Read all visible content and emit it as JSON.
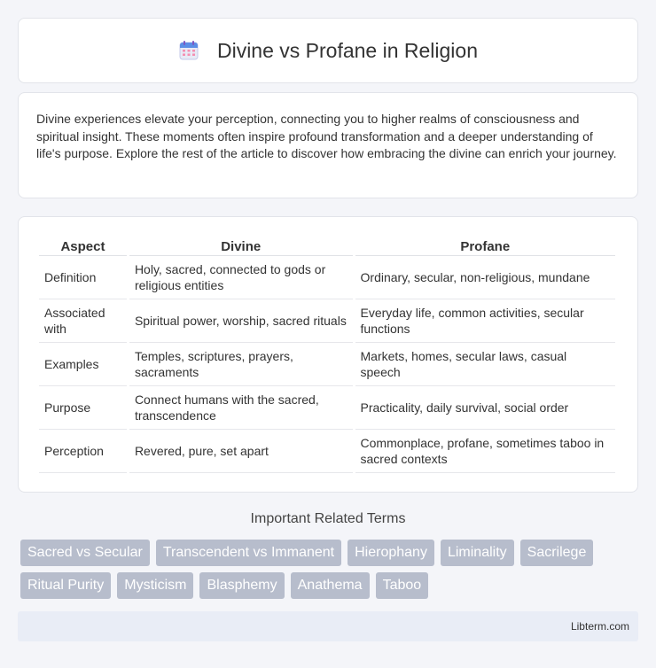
{
  "header": {
    "title": "Divine vs Profane in Religion",
    "icon": "calendar-icon"
  },
  "intro": {
    "text": "Divine experiences elevate your perception, connecting you to higher realms of consciousness and spiritual insight. These moments often inspire profound transformation and a deeper understanding of life's purpose. Explore the rest of the article to discover how embracing the divine can enrich your journey."
  },
  "table": {
    "headers": [
      "Aspect",
      "Divine",
      "Profane"
    ],
    "rows": [
      [
        "Definition",
        "Holy, sacred, connected to gods or religious entities",
        "Ordinary, secular, non-religious, mundane"
      ],
      [
        "Associated with",
        "Spiritual power, worship, sacred rituals",
        "Everyday life, common activities, secular functions"
      ],
      [
        "Examples",
        "Temples, scriptures, prayers, sacraments",
        "Markets, homes, secular laws, casual speech"
      ],
      [
        "Purpose",
        "Connect humans with the sacred, transcendence",
        "Practicality, daily survival, social order"
      ],
      [
        "Perception",
        "Revered, pure, set apart",
        "Commonplace, profane, sometimes taboo in sacred contexts"
      ]
    ]
  },
  "related": {
    "title": "Important Related Terms",
    "tags_row1": [
      "Sacred vs Secular",
      "Transcendent vs Immanent",
      "Hierophany",
      "Liminality",
      "Sacrilege"
    ],
    "tags_row2": [
      "Ritual Purity",
      "Mysticism",
      "Blasphemy",
      "Anathema",
      "Taboo"
    ]
  },
  "footer": {
    "text": "Libterm.com"
  },
  "colors": {
    "tag_bg": "#b7bdcc",
    "footer_bg": "#e9edf6",
    "page_bg": "#f4f5f9"
  }
}
